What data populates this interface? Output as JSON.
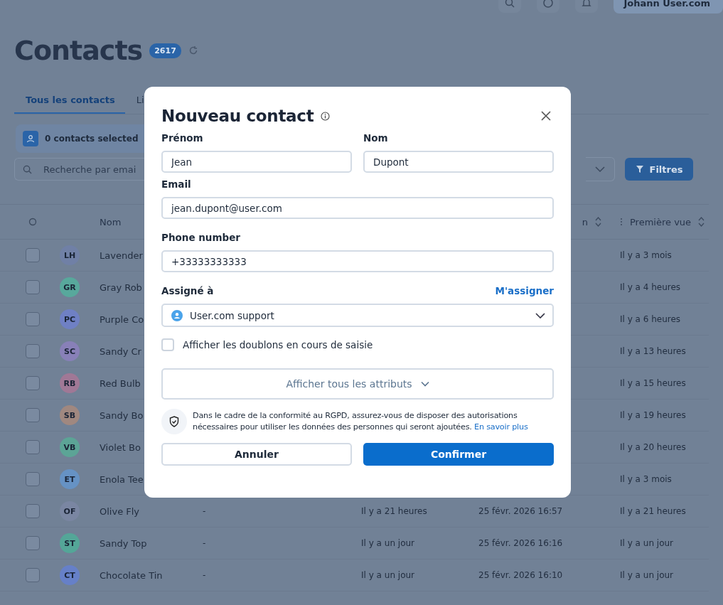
{
  "topbar": {
    "user": "Johann User.com"
  },
  "page": {
    "title": "Contacts",
    "count": "2617"
  },
  "tabs": [
    {
      "label": "Tous les contacts",
      "selected": true
    },
    {
      "label": "Li",
      "selected": false
    }
  ],
  "toolbar": {
    "selection": "0 contacts selected",
    "search_placeholder": "Recherche par emai",
    "filter_button": "Filtres"
  },
  "table": {
    "columns": [
      "Nom",
      "n",
      "Première vue"
    ],
    "rows": [
      {
        "initials": "LH",
        "color": "#7080a6",
        "name": "Lavender",
        "checked": false,
        "first_seen": "Il y a 3 mois"
      },
      {
        "initials": "GR",
        "color": "#58a89c",
        "name": "Gray Rob",
        "checked": false,
        "first_seen": "Il y a 4 heures"
      },
      {
        "initials": "PC",
        "color": "#6f80c4",
        "name": "Purple Co",
        "checked": false,
        "first_seen": "Il y a 6 heures"
      },
      {
        "initials": "SC",
        "color": "#8880b8",
        "name": "Sandy Cr",
        "checked": false,
        "first_seen": "Il y a 13 heures"
      },
      {
        "initials": "RB",
        "color": "#a07896",
        "name": "Red Bulb",
        "checked": false,
        "first_seen": "Il y a 15 heures"
      },
      {
        "initials": "SB",
        "color": "#a08880",
        "name": "Sandy Bo",
        "checked": false,
        "first_seen": "Il y a 19 heures"
      },
      {
        "initials": "VB",
        "color": "#5ca496",
        "name": "Violet Bo",
        "checked": false,
        "first_seen": "Il y a 20 heures"
      },
      {
        "initials": "ET",
        "color": "#6692c4",
        "name": "Enola Tee",
        "checked": false,
        "first_seen": "Il y a 3 mois"
      },
      {
        "initials": "OF",
        "color": "#7a86a2",
        "name": "Olive Fly",
        "checked": false,
        "column_3": "-",
        "column_4": "Il y a 21 heures",
        "column_5": "25 févr. 2026 16:57",
        "first_seen": "Il y a 21 heures"
      },
      {
        "initials": "ST",
        "color": "#54a698",
        "name": "Sandy Top",
        "checked": false,
        "column_3": "-",
        "column_4": "Il y a un jour",
        "column_5": "25 févr. 2026 16:16",
        "first_seen": "Il y a un jour"
      },
      {
        "initials": "CT",
        "color": "#6680c8",
        "name": "Chocolate Tin",
        "checked": false,
        "column_3": "-",
        "column_4": "Il y a un jour",
        "column_5": "25 févr. 2026 16:10",
        "first_seen": "Il y a un jour"
      }
    ]
  },
  "dialog": {
    "title": "Nouveau contact",
    "first_name": {
      "label": "Prénom",
      "value": "Jean"
    },
    "last_name": {
      "label": "Nom",
      "value": "Dupont"
    },
    "email": {
      "label": "Email",
      "value": "jean.dupont@user.com"
    },
    "phone": {
      "label": "Phone number",
      "value": "+33333333333"
    },
    "assignee": {
      "label": "Assigné à",
      "link": "M'assigner",
      "value": "User.com support"
    },
    "duplicates": {
      "label": "Afficher les doublons en cours de saisie",
      "checked": false
    },
    "expand_button": "Afficher tous les attributs",
    "notice": {
      "text": "Dans le cadre de la conformité au RGPD, assurez-vous de disposer des autorisations nécessaires pour utiliser les données des personnes qui seront ajoutées.",
      "link": "En savoir plus"
    },
    "buttons": {
      "cancel": "Annuler",
      "confirm": "Confirmer"
    }
  }
}
